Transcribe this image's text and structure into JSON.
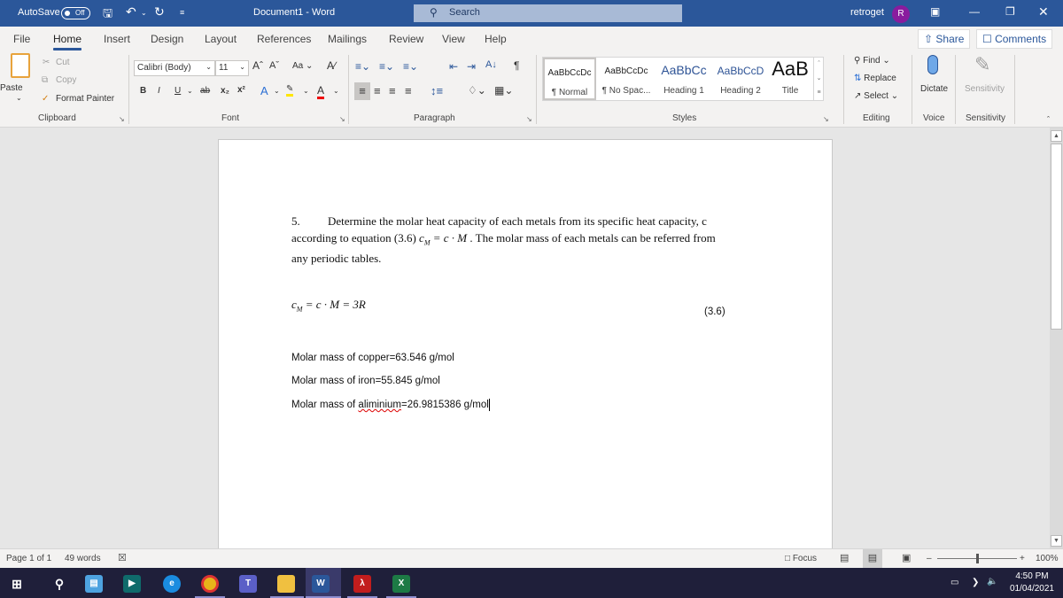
{
  "titlebar": {
    "autosave_label": "AutoSave",
    "autosave_state": "Off",
    "title": "Document1  -  Word",
    "search_placeholder": "Search",
    "user_name": "retroget",
    "avatar_initial": "R",
    "accent_color": "#2b579a"
  },
  "tabs": [
    "File",
    "Home",
    "Insert",
    "Design",
    "Layout",
    "References",
    "Mailings",
    "Review",
    "View",
    "Help"
  ],
  "active_tab": "Home",
  "share_label": "Share",
  "comments_label": "Comments",
  "ribbon": {
    "clipboard": {
      "paste": "Paste",
      "cut": "Cut",
      "copy": "Copy",
      "format_painter": "Format Painter",
      "label": "Clipboard"
    },
    "font": {
      "font_name": "Calibri (Body)",
      "font_size": "11",
      "change_case": "Aa",
      "label": "Font"
    },
    "paragraph": {
      "label": "Paragraph"
    },
    "styles": {
      "label": "Styles",
      "items": [
        {
          "preview": "AaBbCcDc",
          "name": "¶ Normal"
        },
        {
          "preview": "AaBbCcDc",
          "name": "¶ No Spac..."
        },
        {
          "preview": "AaBbCc",
          "name": "Heading 1"
        },
        {
          "preview": "AaBbCcD",
          "name": "Heading 2"
        },
        {
          "preview": "AaB",
          "name": "Title"
        }
      ]
    },
    "editing": {
      "find": "Find",
      "replace": "Replace",
      "select": "Select",
      "label": "Editing"
    },
    "voice": {
      "dictate": "Dictate",
      "label": "Voice"
    },
    "sensitivity": {
      "button": "Sensitivity",
      "label": "Sensitivity"
    }
  },
  "document": {
    "item_number": "5.",
    "para_line1": "Determine the molar heat capacity of each metals from its specific heat capacity, c",
    "para_line2_pre": "according to equation (3.6)",
    "para_line2_eq": "c",
    "para_line2_sub": "M",
    "para_line2_eq_rest": " = c · M",
    "para_line2_post": ". The molar mass of each metals can be referred from",
    "para_line3": "any periodic tables.",
    "equation_c": "c",
    "equation_sub": "M",
    "equation_rest": " = c · M = 3R",
    "equation_number": "(3.6)",
    "line_copper": "Molar mass of copper=63.546 g/mol",
    "line_iron": "Molar mass of iron=55.845 g/mol",
    "line_al_prefix": "Molar mass of ",
    "line_al_misspelled": "aliminium",
    "line_al_suffix": "=26.9815386 g/mol"
  },
  "statusbar": {
    "page": "Page 1 of 1",
    "words": "49 words",
    "focus": "Focus",
    "zoom_percent": "100%",
    "zoom_level": 100
  },
  "taskbar": {
    "time": "4:50 PM",
    "date": "01/04/2021"
  }
}
